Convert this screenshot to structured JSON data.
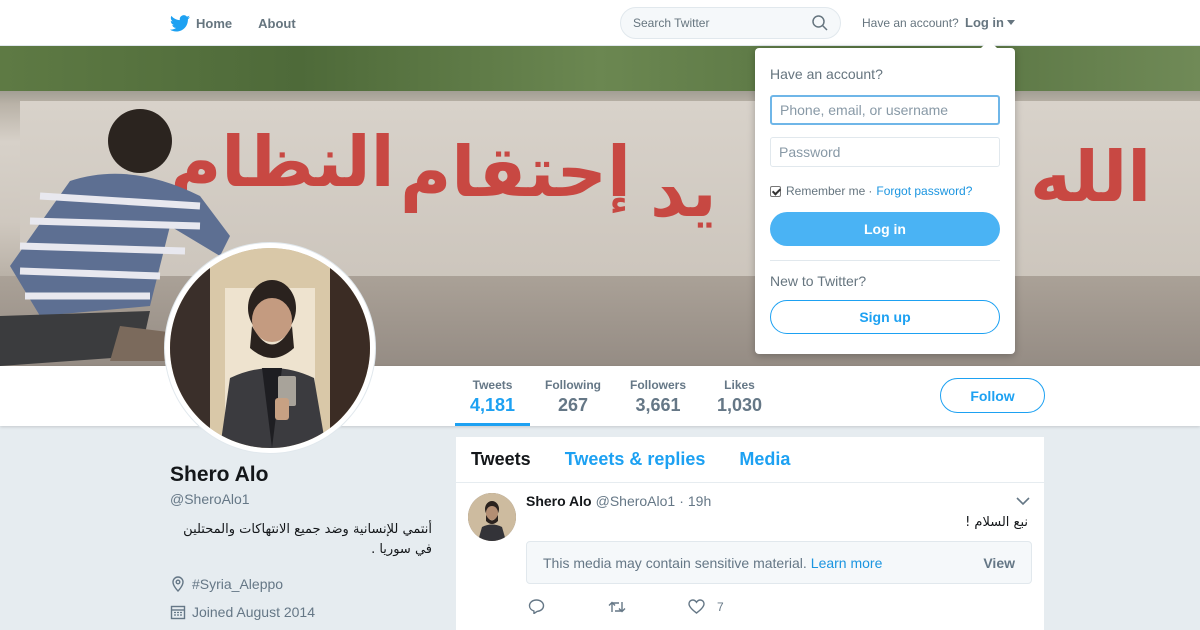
{
  "nav": {
    "home_label": "Home",
    "about_label": "About",
    "search_placeholder": "Search Twitter",
    "have_account": "Have an account?",
    "login_label": "Log in",
    "icons": {
      "logo": "twitter-bird-icon",
      "search": "search-icon",
      "caret": "caret-down-icon"
    }
  },
  "banner": {
    "graffiti": [
      "يد",
      "إحتقام",
      "النظام",
      "الله"
    ]
  },
  "stats": [
    {
      "label": "Tweets",
      "value": "4,181"
    },
    {
      "label": "Following",
      "value": "267"
    },
    {
      "label": "Followers",
      "value": "3,661"
    },
    {
      "label": "Likes",
      "value": "1,030"
    }
  ],
  "follow_label": "Follow",
  "profile": {
    "name": "Shero Alo",
    "handle": "@SheroAlo1",
    "bio": "أنتمي للإنسانية وضد جميع الانتهاكات والمحتلين في سوريا .",
    "location": "#Syria_Aleppo",
    "joined": "Joined August 2014"
  },
  "timeline": {
    "tabs": [
      "Tweets",
      "Tweets & replies",
      "Media"
    ],
    "tweet": {
      "name": "Shero Alo",
      "handle": "@SheroAlo1",
      "dot": "·",
      "time": "19h",
      "text": "نبع السلام !",
      "media_warning": "This media may contain sensitive material.",
      "learn_more": "Learn more",
      "view": "View",
      "like_count": "7"
    }
  },
  "login_dropdown": {
    "title": "Have an account?",
    "user_placeholder": "Phone, email, or username",
    "password_placeholder": "Password",
    "remember": "Remember me",
    "separator": "·",
    "forgot": "Forgot password?",
    "login_button": "Log in",
    "new_to": "New to Twitter?",
    "signup_button": "Sign up"
  },
  "colors": {
    "accent": "#1da1f2",
    "login_button": "#4ab3f4",
    "background": "#e6ecf0"
  }
}
